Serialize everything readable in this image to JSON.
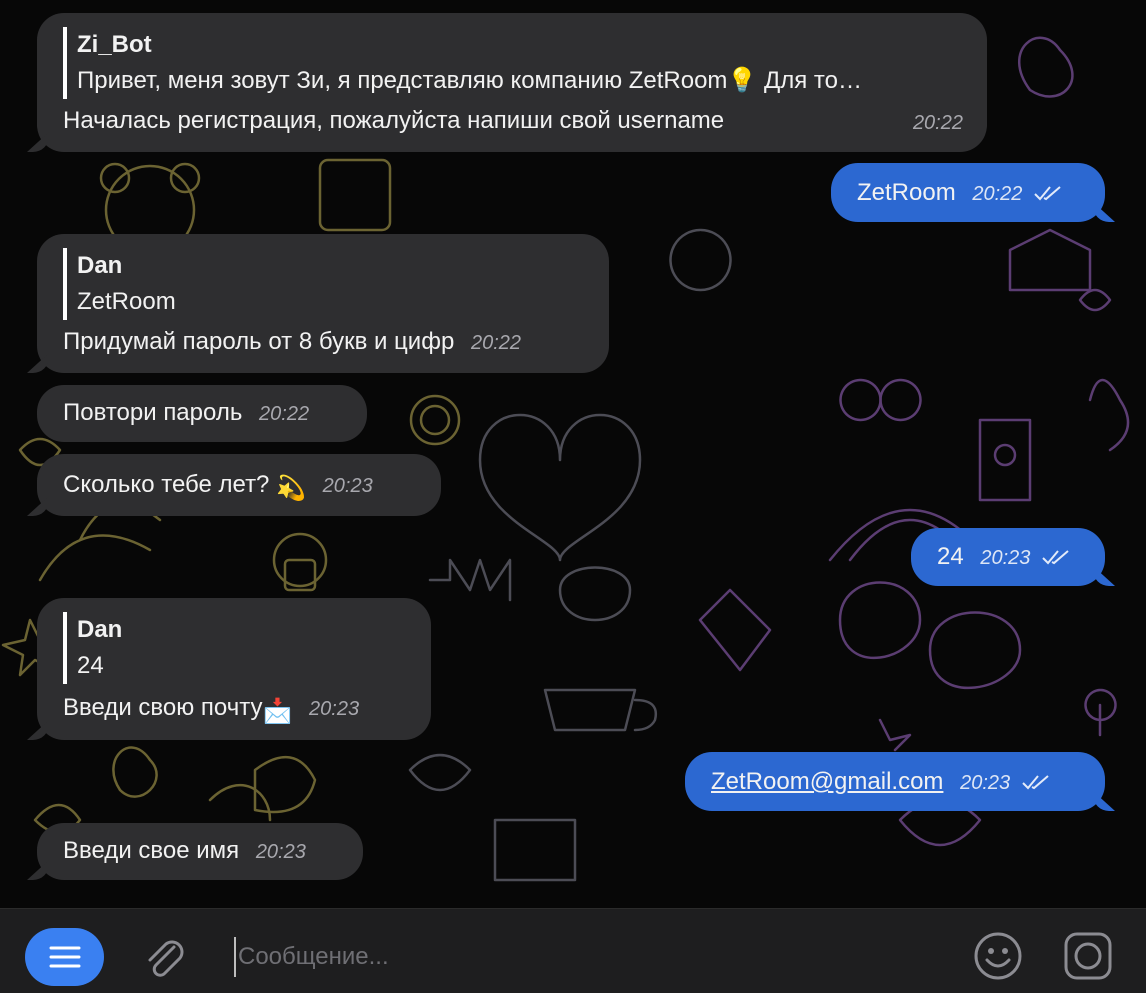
{
  "messages": {
    "m1": {
      "sender": "Zi_Bot",
      "quote": "Привет, меня зовут Зи, я представляю компанию ZetRoom💡 Для то…",
      "text": "Началась регистрация, пожалуйста напиши свой username",
      "time": "20:22"
    },
    "m2": {
      "text": "ZetRoom",
      "time": "20:22"
    },
    "m3": {
      "sender": "Dan",
      "quote": "ZetRoom",
      "text": "Придумай пароль от 8 букв и цифр",
      "time": "20:22"
    },
    "m4": {
      "text": "Повтори пароль",
      "time": "20:22"
    },
    "m5": {
      "text": "Сколько тебе лет?",
      "emoji": "💫",
      "time": "20:23"
    },
    "m6": {
      "text": "24",
      "time": "20:23"
    },
    "m7": {
      "sender": "Dan",
      "quote": "24",
      "text": "Введи свою почту",
      "emoji": "📩",
      "time": "20:23"
    },
    "m8": {
      "text": "ZetRoom@gmail.com",
      "time": "20:23"
    },
    "m9": {
      "text": "Введи свое имя",
      "time": "20:23"
    }
  },
  "composer": {
    "placeholder": "Сообщение..."
  },
  "icons": {
    "menu": "menu-icon",
    "attach": "paperclip-icon",
    "emoji": "smiley-icon",
    "camera": "camera-icon",
    "read": "double-check-icon"
  },
  "colors": {
    "background": "#070707",
    "incoming_bubble": "#2e2e30",
    "outgoing_bubble": "#2c68d1",
    "accent": "#3a80f1"
  }
}
